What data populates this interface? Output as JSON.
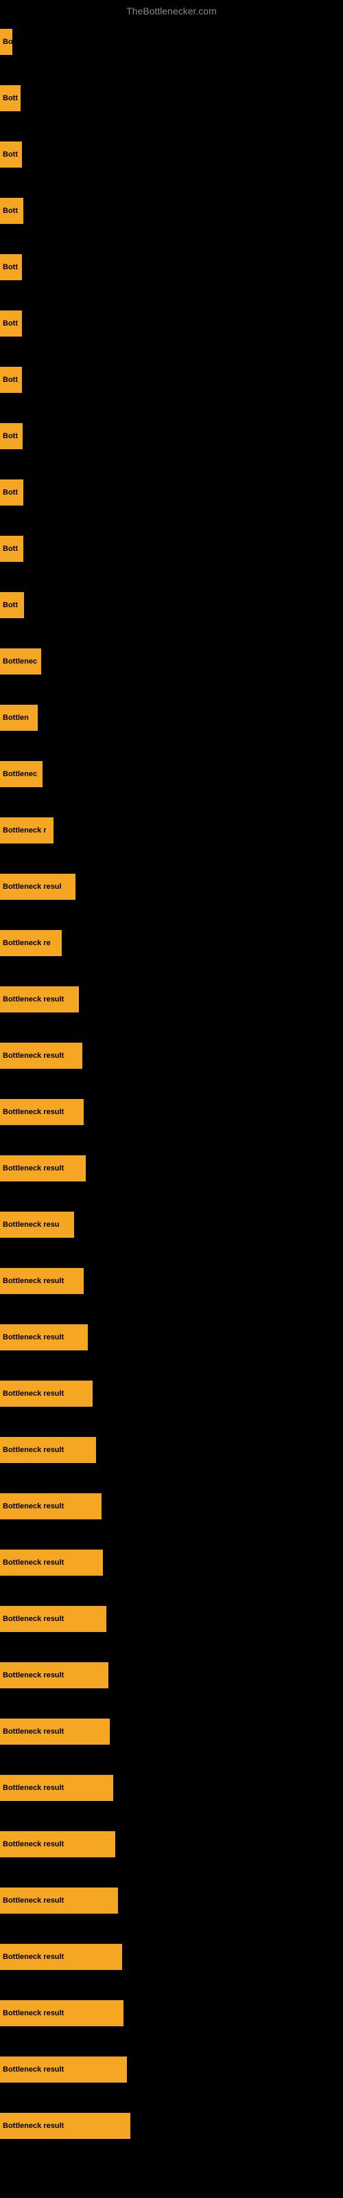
{
  "site_title": "TheBottlenecker.com",
  "bars": [
    {
      "label": "Bo",
      "width": 18
    },
    {
      "label": "Bott",
      "width": 30
    },
    {
      "label": "Bott",
      "width": 32
    },
    {
      "label": "Bott",
      "width": 34
    },
    {
      "label": "Bott",
      "width": 32
    },
    {
      "label": "Bott",
      "width": 32
    },
    {
      "label": "Bott",
      "width": 32
    },
    {
      "label": "Bott",
      "width": 33
    },
    {
      "label": "Bott",
      "width": 34
    },
    {
      "label": "Bott",
      "width": 34
    },
    {
      "label": "Bott",
      "width": 35
    },
    {
      "label": "Bottlenec",
      "width": 60
    },
    {
      "label": "Bottlen",
      "width": 55
    },
    {
      "label": "Bottlenec",
      "width": 62
    },
    {
      "label": "Bottleneck r",
      "width": 78
    },
    {
      "label": "Bottleneck resul",
      "width": 110
    },
    {
      "label": "Bottleneck re",
      "width": 90
    },
    {
      "label": "Bottleneck result",
      "width": 115
    },
    {
      "label": "Bottleneck result",
      "width": 120
    },
    {
      "label": "Bottleneck result",
      "width": 122
    },
    {
      "label": "Bottleneck result",
      "width": 125
    },
    {
      "label": "Bottleneck resu",
      "width": 108
    },
    {
      "label": "Bottleneck result",
      "width": 122
    },
    {
      "label": "Bottleneck result",
      "width": 128
    },
    {
      "label": "Bottleneck result",
      "width": 135
    },
    {
      "label": "Bottleneck result",
      "width": 140
    },
    {
      "label": "Bottleneck result",
      "width": 148
    },
    {
      "label": "Bottleneck result",
      "width": 150
    },
    {
      "label": "Bottleneck result",
      "width": 155
    },
    {
      "label": "Bottleneck result",
      "width": 158
    },
    {
      "label": "Bottleneck result",
      "width": 160
    },
    {
      "label": "Bottleneck result",
      "width": 165
    },
    {
      "label": "Bottleneck result",
      "width": 168
    },
    {
      "label": "Bottleneck result",
      "width": 172
    },
    {
      "label": "Bottleneck result",
      "width": 178
    },
    {
      "label": "Bottleneck result",
      "width": 180
    },
    {
      "label": "Bottleneck result",
      "width": 185
    },
    {
      "label": "Bottleneck result",
      "width": 190
    }
  ]
}
